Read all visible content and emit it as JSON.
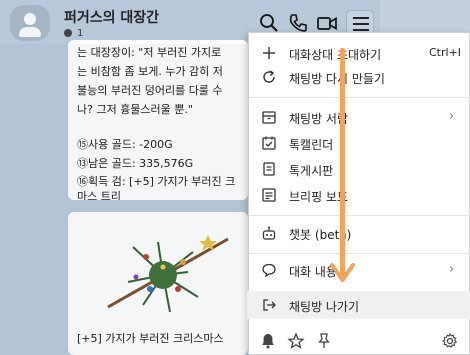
{
  "header": {
    "title": "퍼거스의 대장간",
    "member_count": "1"
  },
  "chat": {
    "message_lines": [
      "는 대장장이: \"저 부러진 가지로",
      "는 비참함 좀 보게. 누가 감히 저",
      "불능의 부러진 덩어리를 다룰 수",
      "나? 그저 흉물스러울 뿐.\"",
      "",
      "⑮사용 골드: -200G",
      "⑬남은 골드: 335,576G",
      "⑯획득 검: [+5] 가지가 부러진 크",
      "마스 트리"
    ],
    "image_caption": "[+5] 가지가 부러진 크리스마스"
  },
  "menu": {
    "items": [
      {
        "label": "대화상대 초대하기",
        "shortcut": "Ctrl+I",
        "icon": "plus-icon"
      },
      {
        "label": "채팅방 다시 만들기",
        "shortcut": "",
        "icon": "refresh-icon"
      },
      {
        "label": "채팅방 서랍",
        "shortcut": "",
        "icon": "drawer-icon",
        "submenu": true
      },
      {
        "label": "톡캘린더",
        "shortcut": "",
        "icon": "calendar-icon"
      },
      {
        "label": "톡게시판",
        "shortcut": "",
        "icon": "board-icon"
      },
      {
        "label": "브리핑 보드",
        "shortcut": "",
        "icon": "briefing-icon"
      },
      {
        "label": "챗봇 (beta)",
        "shortcut": "",
        "icon": "bot-icon"
      },
      {
        "label": "대화 내용",
        "shortcut": "",
        "icon": "chat-bubble-icon",
        "submenu": true
      },
      {
        "label": "채팅방 나가기",
        "shortcut": "",
        "icon": "exit-icon"
      }
    ]
  },
  "colors": {
    "chat_bg": "#b7c8d8",
    "menu_bg": "#ffffff",
    "highlight": "#eef0f2",
    "annotation": "#f5a35a"
  }
}
